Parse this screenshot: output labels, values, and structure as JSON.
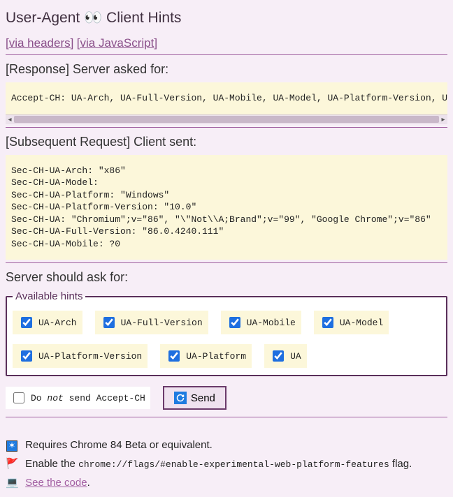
{
  "title_pre": "User-Agent ",
  "title_emoji": "👀",
  "title_post": " Client Hints",
  "nav": {
    "headers": "[via headers]",
    "js": "[via JavaScript]"
  },
  "response": {
    "heading": "[Response] Server asked for:",
    "body": "Accept-CH: UA-Arch, UA-Full-Version, UA-Mobile, UA-Model, UA-Platform-Version, UA-"
  },
  "subsequent": {
    "heading": "[Subsequent Request] Client sent:",
    "body": "Sec-CH-UA-Arch: \"x86\"\nSec-CH-UA-Model:\nSec-CH-UA-Platform: \"Windows\"\nSec-CH-UA-Platform-Version: \"10.0\"\nSec-CH-UA: \"Chromium\";v=\"86\", \"\\\"Not\\\\A;Brand\";v=\"99\", \"Google Chrome\";v=\"86\"\nSec-CH-UA-Full-Version: \"86.0.4240.111\"\nSec-CH-UA-Mobile: ?0"
  },
  "ask": {
    "heading": "Server should ask for:",
    "legend": "Available hints",
    "hints": [
      "UA-Arch",
      "UA-Full-Version",
      "UA-Mobile",
      "UA-Model",
      "UA-Platform-Version",
      "UA-Platform",
      "UA"
    ]
  },
  "no_send": {
    "pre": "Do ",
    "em": "not",
    "post": " send Accept-CH"
  },
  "send_label": "Send",
  "footer": {
    "line1": "Requires Chrome 84 Beta or equivalent.",
    "line2_pre": "Enable the ",
    "line2_code": "chrome://flags/#enable-experimental-web-platform-features",
    "line2_post": " flag.",
    "line3_link": "See the code",
    "line3_post": "."
  }
}
